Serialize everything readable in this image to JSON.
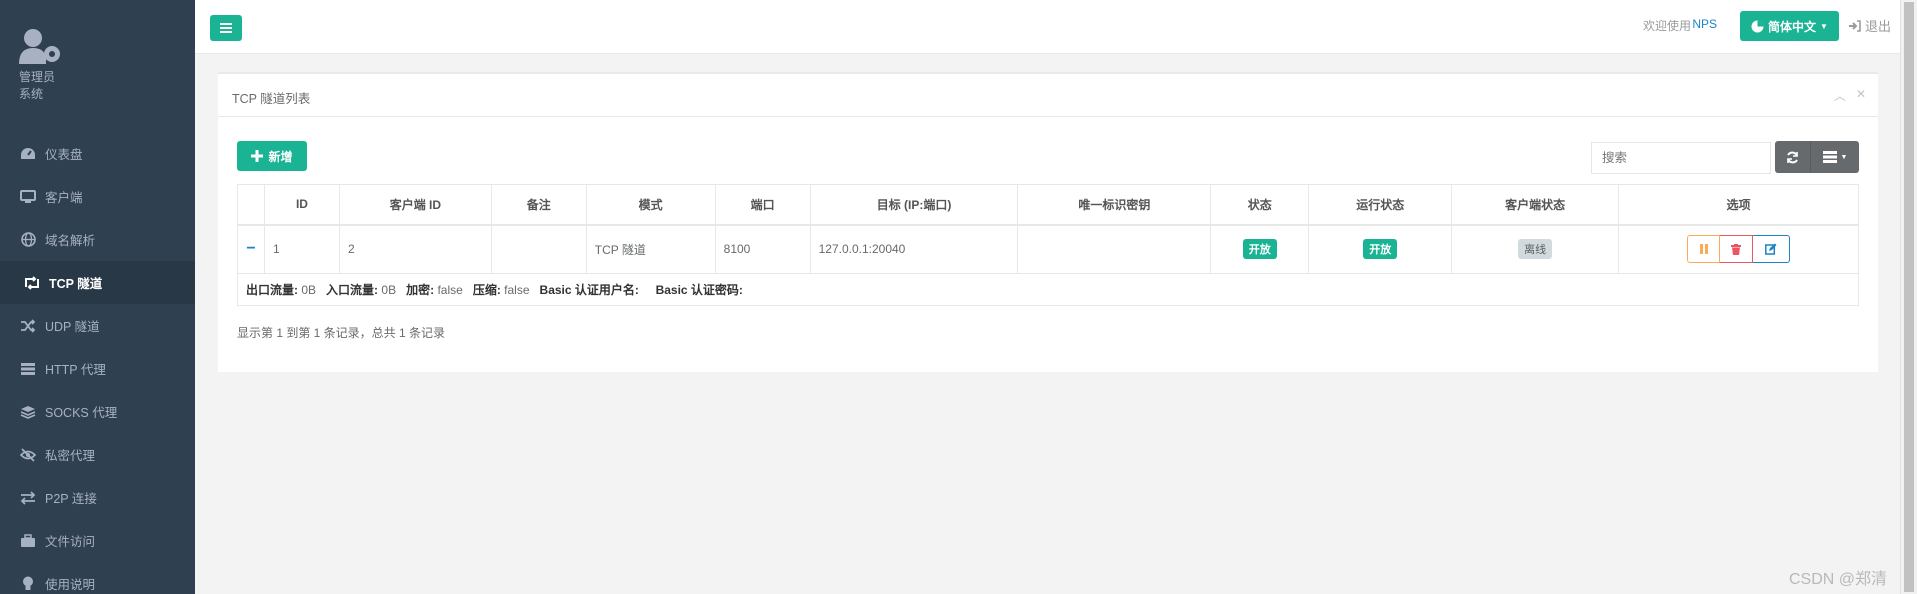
{
  "profile": {
    "name": "管理员",
    "role": "系统"
  },
  "nav": [
    {
      "label": "仪表盘",
      "icon": "dashboard-icon"
    },
    {
      "label": "客户端",
      "icon": "desktop-icon"
    },
    {
      "label": "域名解析",
      "icon": "globe-icon"
    },
    {
      "label": "TCP 隧道",
      "icon": "retweet-icon",
      "active": true
    },
    {
      "label": "UDP 隧道",
      "icon": "random-icon"
    },
    {
      "label": "HTTP 代理",
      "icon": "server-icon"
    },
    {
      "label": "SOCKS 代理",
      "icon": "layers-icon"
    },
    {
      "label": "私密代理",
      "icon": "eye-slash-icon"
    },
    {
      "label": "P2P 连接",
      "icon": "exchange-icon"
    },
    {
      "label": "文件访问",
      "icon": "briefcase-icon"
    },
    {
      "label": "使用说明",
      "icon": "lightbulb-icon"
    }
  ],
  "topbar": {
    "welcome": "欢迎使用",
    "brand": "NPS",
    "language": "简体中文",
    "logout": "退出"
  },
  "panel": {
    "title": "TCP 隧道列表",
    "add_label": "新增",
    "search_placeholder": "搜索"
  },
  "table": {
    "headers": [
      "",
      "ID",
      "客户端 ID",
      "备注",
      "模式",
      "端口",
      "目标 (IP:端口)",
      "唯一标识密钥",
      "状态",
      "运行状态",
      "客户端状态",
      "选项"
    ],
    "row": {
      "expand": "−",
      "id": "1",
      "client_id": "2",
      "remark": "",
      "mode": "TCP 隧道",
      "port": "8100",
      "target": "127.0.0.1:20040",
      "key": "",
      "status": "开放",
      "run_status": "开放",
      "client_status": "离线"
    },
    "detail": {
      "out_label": "出口流量:",
      "out_value": "0B",
      "in_label": "入口流量:",
      "in_value": "0B",
      "crypt_label": "加密:",
      "crypt_value": "false",
      "compress_label": "压缩:",
      "compress_value": "false",
      "basic_user_label": "Basic 认证用户名:",
      "basic_pass_label": "Basic 认证密码:"
    }
  },
  "pager_info": "显示第 1 到第 1 条记录，总共 1 条记录",
  "watermark": "CSDN @郑清",
  "colors": {
    "sidebar": "#2f4050",
    "primary": "#1ab394",
    "warning": "#f8ac59",
    "danger": "#ed5565",
    "info": "#1c84c6"
  }
}
